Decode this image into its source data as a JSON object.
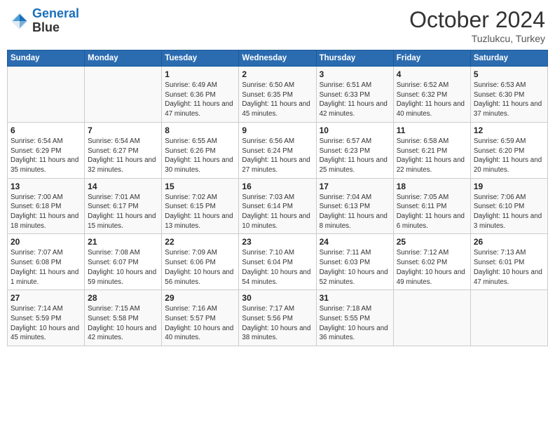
{
  "header": {
    "logo_line1": "General",
    "logo_line2": "Blue",
    "month": "October 2024",
    "location": "Tuzlukcu, Turkey"
  },
  "weekdays": [
    "Sunday",
    "Monday",
    "Tuesday",
    "Wednesday",
    "Thursday",
    "Friday",
    "Saturday"
  ],
  "weeks": [
    [
      {
        "day": "",
        "info": ""
      },
      {
        "day": "",
        "info": ""
      },
      {
        "day": "1",
        "info": "Sunrise: 6:49 AM\nSunset: 6:36 PM\nDaylight: 11 hours and 47 minutes."
      },
      {
        "day": "2",
        "info": "Sunrise: 6:50 AM\nSunset: 6:35 PM\nDaylight: 11 hours and 45 minutes."
      },
      {
        "day": "3",
        "info": "Sunrise: 6:51 AM\nSunset: 6:33 PM\nDaylight: 11 hours and 42 minutes."
      },
      {
        "day": "4",
        "info": "Sunrise: 6:52 AM\nSunset: 6:32 PM\nDaylight: 11 hours and 40 minutes."
      },
      {
        "day": "5",
        "info": "Sunrise: 6:53 AM\nSunset: 6:30 PM\nDaylight: 11 hours and 37 minutes."
      }
    ],
    [
      {
        "day": "6",
        "info": "Sunrise: 6:54 AM\nSunset: 6:29 PM\nDaylight: 11 hours and 35 minutes."
      },
      {
        "day": "7",
        "info": "Sunrise: 6:54 AM\nSunset: 6:27 PM\nDaylight: 11 hours and 32 minutes."
      },
      {
        "day": "8",
        "info": "Sunrise: 6:55 AM\nSunset: 6:26 PM\nDaylight: 11 hours and 30 minutes."
      },
      {
        "day": "9",
        "info": "Sunrise: 6:56 AM\nSunset: 6:24 PM\nDaylight: 11 hours and 27 minutes."
      },
      {
        "day": "10",
        "info": "Sunrise: 6:57 AM\nSunset: 6:23 PM\nDaylight: 11 hours and 25 minutes."
      },
      {
        "day": "11",
        "info": "Sunrise: 6:58 AM\nSunset: 6:21 PM\nDaylight: 11 hours and 22 minutes."
      },
      {
        "day": "12",
        "info": "Sunrise: 6:59 AM\nSunset: 6:20 PM\nDaylight: 11 hours and 20 minutes."
      }
    ],
    [
      {
        "day": "13",
        "info": "Sunrise: 7:00 AM\nSunset: 6:18 PM\nDaylight: 11 hours and 18 minutes."
      },
      {
        "day": "14",
        "info": "Sunrise: 7:01 AM\nSunset: 6:17 PM\nDaylight: 11 hours and 15 minutes."
      },
      {
        "day": "15",
        "info": "Sunrise: 7:02 AM\nSunset: 6:15 PM\nDaylight: 11 hours and 13 minutes."
      },
      {
        "day": "16",
        "info": "Sunrise: 7:03 AM\nSunset: 6:14 PM\nDaylight: 11 hours and 10 minutes."
      },
      {
        "day": "17",
        "info": "Sunrise: 7:04 AM\nSunset: 6:13 PM\nDaylight: 11 hours and 8 minutes."
      },
      {
        "day": "18",
        "info": "Sunrise: 7:05 AM\nSunset: 6:11 PM\nDaylight: 11 hours and 6 minutes."
      },
      {
        "day": "19",
        "info": "Sunrise: 7:06 AM\nSunset: 6:10 PM\nDaylight: 11 hours and 3 minutes."
      }
    ],
    [
      {
        "day": "20",
        "info": "Sunrise: 7:07 AM\nSunset: 6:08 PM\nDaylight: 11 hours and 1 minute."
      },
      {
        "day": "21",
        "info": "Sunrise: 7:08 AM\nSunset: 6:07 PM\nDaylight: 10 hours and 59 minutes."
      },
      {
        "day": "22",
        "info": "Sunrise: 7:09 AM\nSunset: 6:06 PM\nDaylight: 10 hours and 56 minutes."
      },
      {
        "day": "23",
        "info": "Sunrise: 7:10 AM\nSunset: 6:04 PM\nDaylight: 10 hours and 54 minutes."
      },
      {
        "day": "24",
        "info": "Sunrise: 7:11 AM\nSunset: 6:03 PM\nDaylight: 10 hours and 52 minutes."
      },
      {
        "day": "25",
        "info": "Sunrise: 7:12 AM\nSunset: 6:02 PM\nDaylight: 10 hours and 49 minutes."
      },
      {
        "day": "26",
        "info": "Sunrise: 7:13 AM\nSunset: 6:01 PM\nDaylight: 10 hours and 47 minutes."
      }
    ],
    [
      {
        "day": "27",
        "info": "Sunrise: 7:14 AM\nSunset: 5:59 PM\nDaylight: 10 hours and 45 minutes."
      },
      {
        "day": "28",
        "info": "Sunrise: 7:15 AM\nSunset: 5:58 PM\nDaylight: 10 hours and 42 minutes."
      },
      {
        "day": "29",
        "info": "Sunrise: 7:16 AM\nSunset: 5:57 PM\nDaylight: 10 hours and 40 minutes."
      },
      {
        "day": "30",
        "info": "Sunrise: 7:17 AM\nSunset: 5:56 PM\nDaylight: 10 hours and 38 minutes."
      },
      {
        "day": "31",
        "info": "Sunrise: 7:18 AM\nSunset: 5:55 PM\nDaylight: 10 hours and 36 minutes."
      },
      {
        "day": "",
        "info": ""
      },
      {
        "day": "",
        "info": ""
      }
    ]
  ]
}
